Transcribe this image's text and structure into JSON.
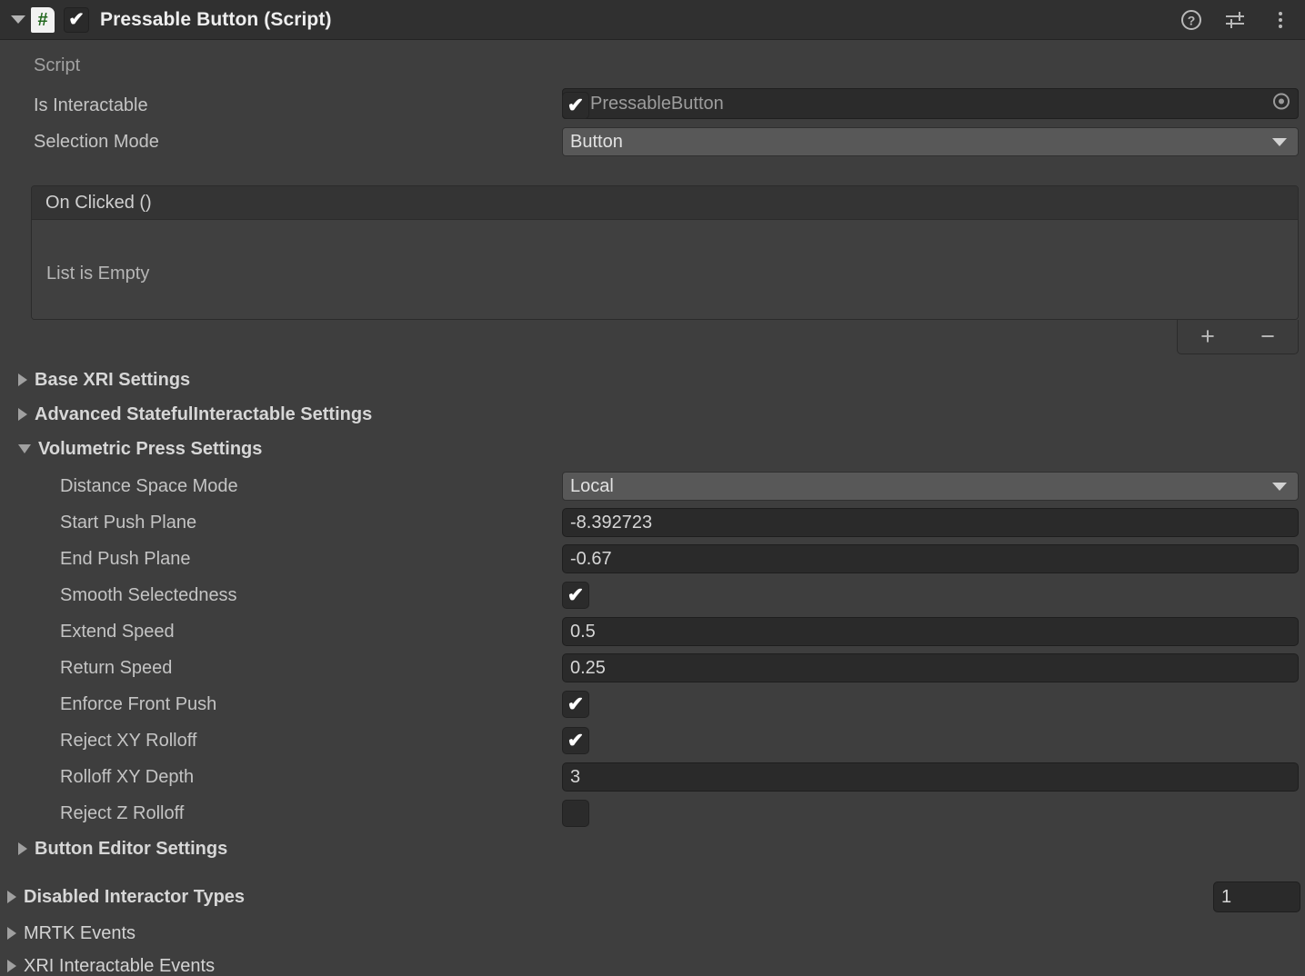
{
  "header": {
    "title": "Pressable Button (Script)",
    "enabled_checkbox": "✔",
    "script_glyph": "#",
    "help_icon": "help-icon",
    "preset_icon": "preset-icon",
    "menu_icon": "more-menu-icon"
  },
  "script_row": {
    "label": "Script",
    "value": "PressableButton",
    "glyph": "#"
  },
  "is_interactable": {
    "label": "Is Interactable",
    "checked": true,
    "mark": "✔"
  },
  "selection_mode": {
    "label": "Selection Mode",
    "value": "Button"
  },
  "on_clicked": {
    "header": "On Clicked ()",
    "empty_text": "List is Empty",
    "add_label": "+",
    "remove_label": "−"
  },
  "foldouts": {
    "base_xri": "Base XRI Settings",
    "advanced_stateful": "Advanced StatefulInteractable Settings",
    "volumetric_press": "Volumetric Press Settings",
    "button_editor": "Button Editor Settings",
    "disabled_interactor_types": "Disabled Interactor Types",
    "mrtk_events": "MRTK Events",
    "xri_interactable_events": "XRI Interactable Events"
  },
  "volumetric": {
    "distance_space_mode": {
      "label": "Distance Space Mode",
      "value": "Local"
    },
    "start_push_plane": {
      "label": "Start Push Plane",
      "value": "-8.392723"
    },
    "end_push_plane": {
      "label": "End Push Plane",
      "value": "-0.67"
    },
    "smooth_selectedness": {
      "label": "Smooth Selectedness",
      "checked": true,
      "mark": "✔"
    },
    "extend_speed": {
      "label": "Extend Speed",
      "value": "0.5"
    },
    "return_speed": {
      "label": "Return Speed",
      "value": "0.25"
    },
    "enforce_front_push": {
      "label": "Enforce Front Push",
      "checked": true,
      "mark": "✔"
    },
    "reject_xy_rolloff": {
      "label": "Reject XY Rolloff",
      "checked": true,
      "mark": "✔"
    },
    "rolloff_xy_depth": {
      "label": "Rolloff XY Depth",
      "value": "3"
    },
    "reject_z_rolloff": {
      "label": "Reject Z Rolloff",
      "checked": false,
      "mark": ""
    }
  },
  "disabled_interactor_count": "1",
  "colors": {
    "background": "#3e3e3e",
    "header_bar": "#303030",
    "field_dark": "#2a2a2a",
    "popup_gray": "#585858",
    "text": "#c4c4c4",
    "script_green": "#23681f"
  }
}
